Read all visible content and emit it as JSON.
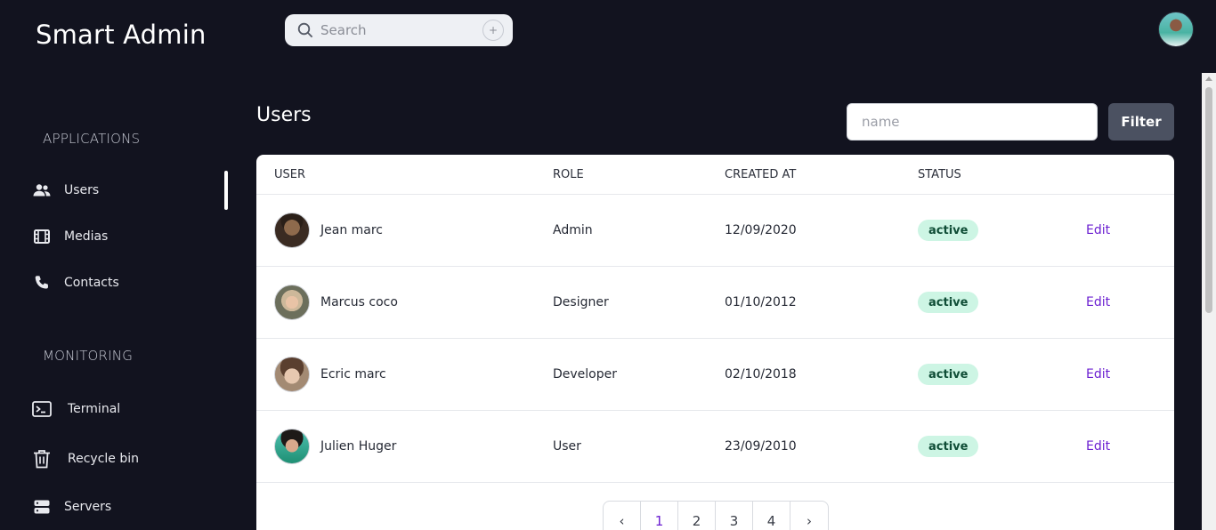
{
  "app": {
    "title": "Smart Admin"
  },
  "search": {
    "placeholder": "Search",
    "shortcut": "+"
  },
  "sidebar": {
    "sections": [
      {
        "title": "APPLICATIONS",
        "items": [
          {
            "label": "Users",
            "icon": "users-icon"
          },
          {
            "label": "Medias",
            "icon": "film-icon"
          },
          {
            "label": "Contacts",
            "icon": "phone-icon"
          }
        ]
      },
      {
        "title": "MONITORING",
        "items": [
          {
            "label": "Terminal",
            "icon": "terminal-icon"
          },
          {
            "label": "Recycle bin",
            "icon": "trash-icon"
          },
          {
            "label": "Servers",
            "icon": "server-icon"
          }
        ]
      }
    ],
    "active_item": "Users"
  },
  "main": {
    "title": "Users",
    "filter": {
      "placeholder": "name",
      "value": "",
      "button_label": "Filter"
    },
    "table": {
      "columns": [
        "USER",
        "ROLE",
        "CREATED AT",
        "STATUS"
      ],
      "rows": [
        {
          "user": "Jean marc",
          "role": "Admin",
          "created_at": "12/09/2020",
          "status": "active",
          "action": "Edit"
        },
        {
          "user": "Marcus coco",
          "role": "Designer",
          "created_at": "01/10/2012",
          "status": "active",
          "action": "Edit"
        },
        {
          "user": "Ecric marc",
          "role": "Developer",
          "created_at": "02/10/2018",
          "status": "active",
          "action": "Edit"
        },
        {
          "user": "Julien Huger",
          "role": "User",
          "created_at": "23/09/2010",
          "status": "active",
          "action": "Edit"
        }
      ]
    },
    "pagination": {
      "prev": "‹",
      "pages": [
        "1",
        "2",
        "3",
        "4"
      ],
      "current": "1",
      "next": "›"
    }
  },
  "colors": {
    "background": "#12131f",
    "accent": "#6b1fd1",
    "badge_bg": "#cdf5e4",
    "badge_text": "#0f4d36",
    "filter_button": "#4b5161"
  }
}
